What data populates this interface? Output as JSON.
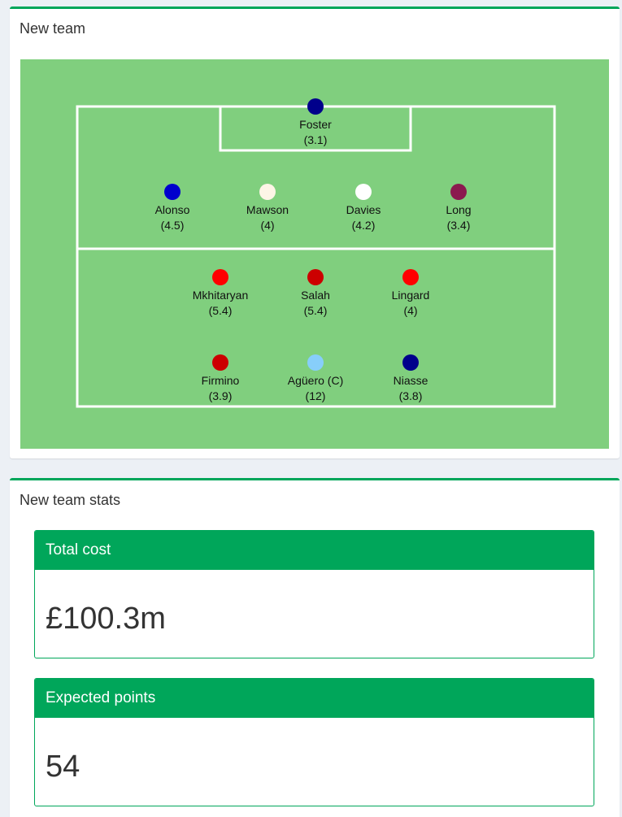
{
  "team_box": {
    "title": "New team",
    "players": [
      {
        "name": "Foster",
        "value": "(3.1)",
        "color": "#00008b"
      },
      {
        "name": "Alonso",
        "value": "(4.5)",
        "color": "#0000cd"
      },
      {
        "name": "Mawson",
        "value": "(4)",
        "color": "#fdf5e6"
      },
      {
        "name": "Davies",
        "value": "(4.2)",
        "color": "#ffffff"
      },
      {
        "name": "Long",
        "value": "(3.4)",
        "color": "#8b1a4f"
      },
      {
        "name": "Mkhitaryan",
        "value": "(5.4)",
        "color": "#ff0000"
      },
      {
        "name": "Salah",
        "value": "(5.4)",
        "color": "#cc0000"
      },
      {
        "name": "Lingard",
        "value": "(4)",
        "color": "#ff0000"
      },
      {
        "name": "Firmino",
        "value": "(3.9)",
        "color": "#cc0000"
      },
      {
        "name": "Agüero (C)",
        "value": "(12)",
        "color": "#87cefa"
      },
      {
        "name": "Niasse",
        "value": "(3.8)",
        "color": "#00008b"
      }
    ]
  },
  "stats_box": {
    "title": "New team stats",
    "total_cost": {
      "label": "Total cost",
      "value": "£100.3m"
    },
    "expected_points": {
      "label": "Expected points",
      "value": "54"
    }
  },
  "colors": {
    "accent": "#00a65a",
    "pitch": "#80cf7e",
    "pitch_lines": "#ffffff"
  }
}
